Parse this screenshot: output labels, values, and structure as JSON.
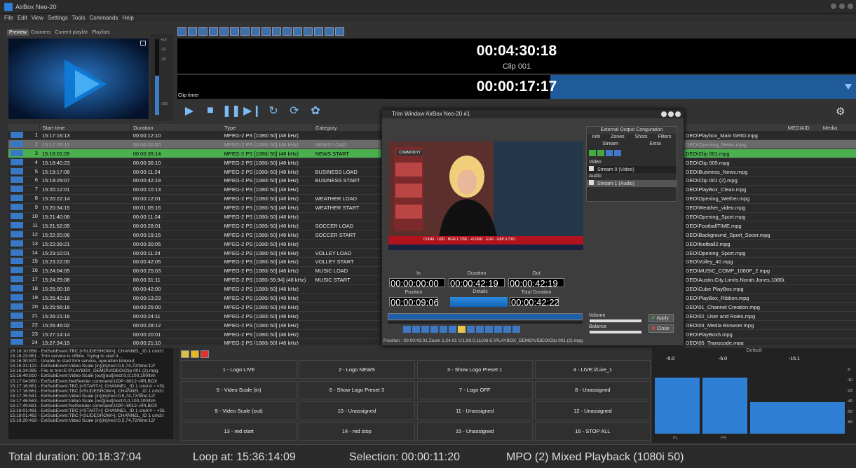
{
  "window": {
    "title": "AirBox Neo-20"
  },
  "menu": [
    "File",
    "Edit",
    "View",
    "Settings",
    "Tools",
    "Commands",
    "Help"
  ],
  "left_tabs": [
    "Preview",
    "Counters",
    "Current playlist",
    "Playlists"
  ],
  "vu_scale": [
    "+10",
    "-10",
    "-20",
    "-100-"
  ],
  "timer": {
    "countdown": "00:04:30:18",
    "clip": "Clip 001",
    "clip_timer_label": "Clip timer",
    "clip_timer": "00:00:17:17",
    "clip_progress": 0.55
  },
  "grid": {
    "headers": [
      "",
      "Start time",
      "Duration",
      "Type",
      "Category"
    ],
    "rows": [
      {
        "n": "1",
        "start": "15:17:16:13",
        "dur": "00:00:12:10",
        "type": "MPEG-2 PS [1080i 50] (48 kHz)",
        "cat": "",
        "cls": ""
      },
      {
        "n": "2",
        "start": "15:17:28:13",
        "dur": "00:00:00:00",
        "type": "MPEG-2 PS [1080i 50] (48 kHz)",
        "cat": "NEWS LOAD",
        "cls": "dim"
      },
      {
        "n": "3",
        "start": "15:18:01:09",
        "dur": "00:00:39:14",
        "type": "MPEG-2 PS [1080i 50] (48 kHz)",
        "cat": "NEWS START",
        "cls": "sel"
      },
      {
        "n": "4",
        "start": "15:18:40:23",
        "dur": "00:00:36:10",
        "type": "MPEG-2 PS [1080i 50] (48 kHz)",
        "cat": "",
        "cls": ""
      },
      {
        "n": "5",
        "start": "15:19:17:08",
        "dur": "00:00:11:24",
        "type": "MPEG-2 PS [1080i 50] (48 kHz)",
        "cat": "BUSINESS LOAD",
        "cls": ""
      },
      {
        "n": "6",
        "start": "15:19:29:07",
        "dur": "00:00:42:19",
        "type": "MPEG-2 PS [1080i 50] (48 kHz)",
        "cat": "BUSINESS START",
        "cls": ""
      },
      {
        "n": "7",
        "start": "15:20:12:01",
        "dur": "00:00:10:13",
        "type": "MPEG-2 PS [1080i 50] (48 kHz)",
        "cat": "",
        "cls": ""
      },
      {
        "n": "8",
        "start": "15:20:22:14",
        "dur": "00:00:12:01",
        "type": "MPEG-2 PS [1080i 50] (48 kHz)",
        "cat": "WEATHER LOAD",
        "cls": ""
      },
      {
        "n": "9",
        "start": "15:20:34:15",
        "dur": "00:01:05:16",
        "type": "MPEG-2 PS [1080i 50] (48 kHz)",
        "cat": "WEATHER START",
        "cls": ""
      },
      {
        "n": "10",
        "start": "15:21:40:06",
        "dur": "00:00:11:24",
        "type": "MPEG-2 PS [1080i 50] (48 kHz)",
        "cat": "",
        "cls": ""
      },
      {
        "n": "11",
        "start": "15:21:52:05",
        "dur": "00:00:28:01",
        "type": "MPEG-2 PS [1080i 50] (48 kHz)",
        "cat": "SOCCER LOAD",
        "cls": ""
      },
      {
        "n": "12",
        "start": "15:22:20:06",
        "dur": "00:00:19:15",
        "type": "MPEG-2 PS [1080i 50] (48 kHz)",
        "cat": "SOCCER START",
        "cls": ""
      },
      {
        "n": "13",
        "start": "15:22:39:21",
        "dur": "00:00:30:05",
        "type": "MPEG-2 PS [1080i 50] (48 kHz)",
        "cat": "",
        "cls": ""
      },
      {
        "n": "14",
        "start": "15:23:10:01",
        "dur": "00:00:11:24",
        "type": "MPEG-2 PS [1080i 50] (48 kHz)",
        "cat": "VOLLEY LOAD",
        "cls": ""
      },
      {
        "n": "15",
        "start": "15:23:22:00",
        "dur": "00:00:42:05",
        "type": "MPEG-2 PS [1080i 50] (48 kHz)",
        "cat": "VOLLEY START",
        "cls": ""
      },
      {
        "n": "16",
        "start": "15:24:04:05",
        "dur": "00:00:25:03",
        "type": "MPEG-2 PS [1080i 50] (48 kHz)",
        "cat": "MUSIC LOAD",
        "cls": ""
      },
      {
        "n": "17",
        "start": "15:24:29:08",
        "dur": "00:00:31:11",
        "type": "MPEG-2 PS [1080i 59.94] (48 kHz)",
        "cat": "MUSIC START",
        "cls": ""
      },
      {
        "n": "18",
        "start": "15:25:00:18",
        "dur": "00:00:42:00",
        "type": "MPEG-2 PS [1080i 50] (48 kHz)",
        "cat": "",
        "cls": ""
      },
      {
        "n": "19",
        "start": "15:25:42:18",
        "dur": "00:00:13:23",
        "type": "MPEG-2 PS [1080i 50] (48 kHz)",
        "cat": "",
        "cls": ""
      },
      {
        "n": "20",
        "start": "15:25:56:16",
        "dur": "00:00:25:00",
        "type": "MPEG-2 PS [1080i 50] (48 kHz)",
        "cat": "",
        "cls": ""
      },
      {
        "n": "21",
        "start": "15:26:21:16",
        "dur": "00:00:24:11",
        "type": "MPEG-2 PS [1080i 50] (48 kHz)",
        "cat": "",
        "cls": ""
      },
      {
        "n": "22",
        "start": "15:26:46:02",
        "dur": "00:00:28:12",
        "type": "MPEG-2 PS [1080i 50] (48 kHz)",
        "cat": "",
        "cls": ""
      },
      {
        "n": "23",
        "start": "15:27:14:14",
        "dur": "00:00:20:01",
        "type": "MPEG-2 PS [1080i 50] (48 kHz)",
        "cat": "",
        "cls": ""
      },
      {
        "n": "24",
        "start": "15:27:34:15",
        "dur": "00:00:21:10",
        "type": "MPEG-2 PS [1080i 50] (48 kHz)",
        "cat": "",
        "cls": ""
      }
    ]
  },
  "rgrid": {
    "headers": [
      "",
      "MEDIAID",
      "Media"
    ],
    "rows": [
      {
        "f": "DEO\\Playbox_Main GRID.mpg",
        "cls": ""
      },
      {
        "f": "DEO\\Opening_News.mpg",
        "cls": "dim"
      },
      {
        "f": "DEO\\Clip 001.mpg",
        "cls": "sel"
      },
      {
        "f": "DEO\\Clip 005.mpg",
        "cls": ""
      },
      {
        "f": "DEO\\Business_News.mpg",
        "cls": ""
      },
      {
        "f": "DEO\\Clip 001 (2).mpg",
        "cls": ""
      },
      {
        "f": "DEO\\PlayBox_Clean.mpg",
        "cls": ""
      },
      {
        "f": "DEO\\Opening_Wether.mpg",
        "cls": ""
      },
      {
        "f": "DEO\\Weather_video.mpg",
        "cls": ""
      },
      {
        "f": "DEO\\Opening_Sport.mpg",
        "cls": ""
      },
      {
        "f": "DEO\\FootballTIME.mpg",
        "cls": ""
      },
      {
        "f": "DEO\\Background_Sport_Socer.mpg",
        "cls": ""
      },
      {
        "f": "DEO\\football2.mpg",
        "cls": ""
      },
      {
        "f": "DEO\\Opening_Sport.mpg",
        "cls": ""
      },
      {
        "f": "DEO\\Volley_40.mpg",
        "cls": ""
      },
      {
        "f": "DEO\\MUSIC_COMP_1080P_2.mpg",
        "cls": ""
      },
      {
        "f": "DEO\\Austin.City.Limits.Norah.Jones.1080i.",
        "cls": ""
      },
      {
        "f": "DEO\\Cube PlayBox.mpg",
        "cls": ""
      },
      {
        "f": "DEO\\PlayBox_Ribbon.mpg",
        "cls": ""
      },
      {
        "f": "DEO\\01_Channel Creation.mpg",
        "cls": ""
      },
      {
        "f": "DEO\\02_User and Roles.mpg",
        "cls": ""
      },
      {
        "f": "DEO\\03_Media Browser.mpg",
        "cls": ""
      },
      {
        "f": "DEO\\PlayBox5.mpg",
        "cls": ""
      },
      {
        "f": "DEO\\05_Transcode.mpg",
        "cls": ""
      }
    ]
  },
  "trim": {
    "title": "Trim Window AirBox Neo-20 #1",
    "cfg_title": "External Output Conguration",
    "cfg_tabs": [
      "Info",
      "Zones",
      "Shots",
      "Filters"
    ],
    "cfg_tabs2": [
      "Stream",
      "Extra"
    ],
    "video_label": "Video",
    "video_stream": "Stream 0 (Video)",
    "audio_label": "Audio",
    "audio_stream": "Stream 1 (Audio)",
    "in_label": "In",
    "in": "00:00:00:00",
    "dur_label": "Duration",
    "dur": "00:00:42:19",
    "out_label": "Out",
    "out": "00:00:42:19",
    "pos_label": "Position",
    "pos": "00:00:09:06",
    "details_label": "Details",
    "total_label": "Total Duration",
    "total": "00:00:42:22",
    "volume_label": "Volume",
    "balance_label": "Balance",
    "apply": "Apply",
    "close": "Close",
    "status": "Position : 00:00:41:01   Zoom 1:24.01   V:1.99.0.11106   E:\\PLAYBOX_DEMO\\VIDEO\\Clip 001 (2).mpg",
    "ticker": [
      "0.0046",
      "USD",
      "BGN 1.7256",
      "+0.0041",
      "EUR",
      "GBP 0.7351"
    ],
    "commodity": "COMMODITY"
  },
  "log": [
    "15:16:10:858 - ExtSubEvent:TBC [<SLIDESHOW>]; CHANNEL_ID 1 cmd:t",
    "15:16:23:851 - Trim service is offline. Trying to start it...",
    "15:16:30:870 - Unable to start trim service, operation timeout",
    "15:16:31:122 - ExtSubEvent:Video Scale (in)[in]/rect:0,5,74,72/time:12/",
    "15:16:34:395 - File to trim:E:\\PLAYBOX_DEMO\\VIDEO\\Clip 001 (2).mpg",
    "15:16:40:810 - ExtSubEvent:Video Scale (out)[out]/rect:0,0,100,100/tim",
    "15:17:04:860 - ExtSubEvent:NetSender command;UDP~8012~#PLBOX",
    "15:17:16:661 - ExtSubEvent:TBC [<START>]; CHANNEL_ID 1 cmd:4 ~ <SL",
    "15:17:16:661 - ExtSubEvent:TBC [<SLIDESHOW>]; CHANNEL_ID 1 cmd:t",
    "15:17:35:541 - ExtSubEvent:Video Scale (in)[in]/rect:0,5,74,72/time:12/",
    "15:17:46:563 - ExtSubEvent:Video Scale (out)[out]/rect:0,0,100,100/tim",
    "15:17:49:691 - ExtSubEvent:NetSender command;UDP~8012~#PLBOX",
    "15:18:01:481 - ExtSubEvent:TBC [<START>]; CHANNEL_ID 1 cmd:4 ~ <SL",
    "15:18:01:482 - ExtSubEvent:TBC [<SLIDESHOW>]; CHANNEL_ID 1 cmd:t",
    "15:18:20:418 - ExtSubEvent:Video Scale (in)[in]/rect:0,5,74,72/time:12/"
  ],
  "macros": [
    "1 - Logo LIVE",
    "2 - Logo NEWS",
    "3 - Show Logo Preset 1",
    "4 - LIVE://Live_1",
    "5 - Video Scale (in)",
    "6 - Show Logo Preset 3",
    "7 - Logo OFF",
    "8 - Unassigned",
    "9 - Video Scale (out)",
    "10 - Unassigned",
    "11 - Unassigned",
    "12 - Unassigned",
    "13 - red start",
    "14 - red stop",
    "15 - Unassigned",
    "16 - STOP ALL"
  ],
  "meter": {
    "header": "Default",
    "vals": [
      "-5.0",
      "-5.0",
      "-15.1"
    ],
    "scale": [
      "-0",
      "-10",
      "-23",
      "-40",
      "-50",
      "-60"
    ],
    "ch": [
      "FL",
      "FR"
    ],
    "levels": [
      0.8,
      0.8,
      0.45
    ]
  },
  "status": {
    "total": "Total duration: 00:18:37:04",
    "loop": "Loop at: 15:36:14:09",
    "selection": "Selection: 00:00:11:20",
    "mode": "MPO (2) Mixed Playback (1080i 50)"
  }
}
